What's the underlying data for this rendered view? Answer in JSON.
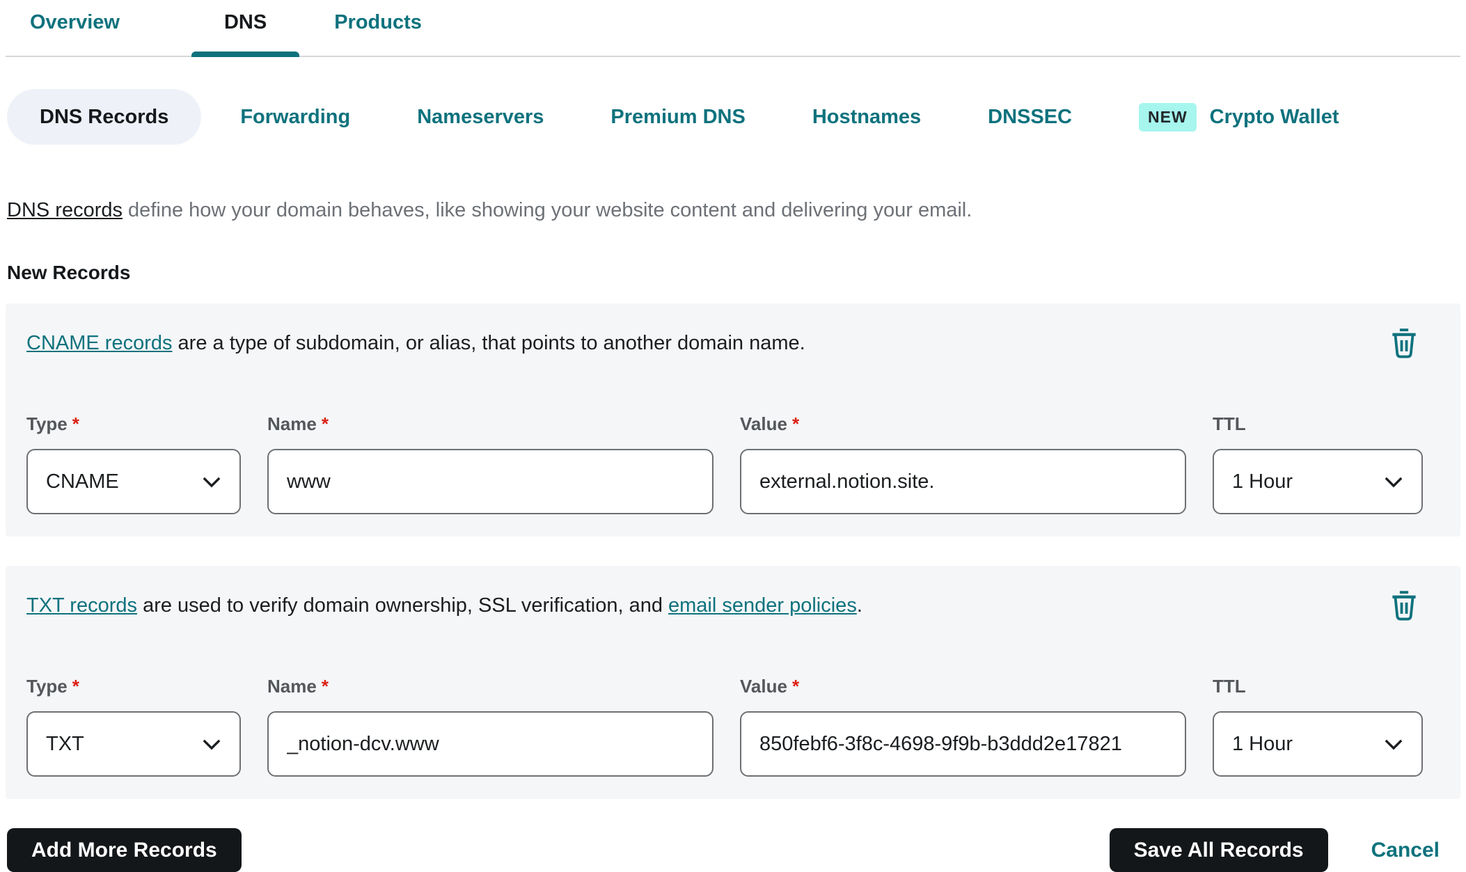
{
  "colors": {
    "accent_teal": "#0e727d",
    "new_badge_bg": "#a6f6ee",
    "card_bg": "#f5f6f8",
    "active_pill_bg": "#eef2f8",
    "button_bg": "#141719",
    "required_red": "#db2114"
  },
  "tabs": {
    "overview": "Overview",
    "dns": "DNS",
    "products": "Products"
  },
  "subtabs": {
    "dns_records": "DNS Records",
    "forwarding": "Forwarding",
    "nameservers": "Nameservers",
    "premium_dns": "Premium DNS",
    "hostnames": "Hostnames",
    "dnssec": "DNSSEC",
    "new_badge": "NEW",
    "crypto_wallet": "Crypto Wallet"
  },
  "intro": {
    "link_text": "DNS records",
    "rest_text": " define how your domain behaves, like showing your website content and delivering your email."
  },
  "section_title": "New Records",
  "field_labels": {
    "type": "Type",
    "name": "Name",
    "value": "Value",
    "ttl": "TTL",
    "required": "*"
  },
  "records": [
    {
      "desc_link1": "CNAME records",
      "desc_mid": " are a type of subdomain, or alias, that points to another domain name.",
      "desc_link2": "",
      "desc_tail": "",
      "type": "CNAME",
      "name": "www",
      "value": "external.notion.site.",
      "ttl": "1 Hour"
    },
    {
      "desc_link1": "TXT records",
      "desc_mid": " are used to verify domain ownership, SSL verification, and ",
      "desc_link2": "email sender policies",
      "desc_tail": ".",
      "type": "TXT",
      "name": "_notion-dcv.www",
      "value": "850febf6-3f8c-4698-9f9b-b3ddd2e17821",
      "ttl": "1 Hour"
    }
  ],
  "footer": {
    "add_button": "Add More Records",
    "save_button": "Save All Records",
    "cancel_link": "Cancel"
  }
}
